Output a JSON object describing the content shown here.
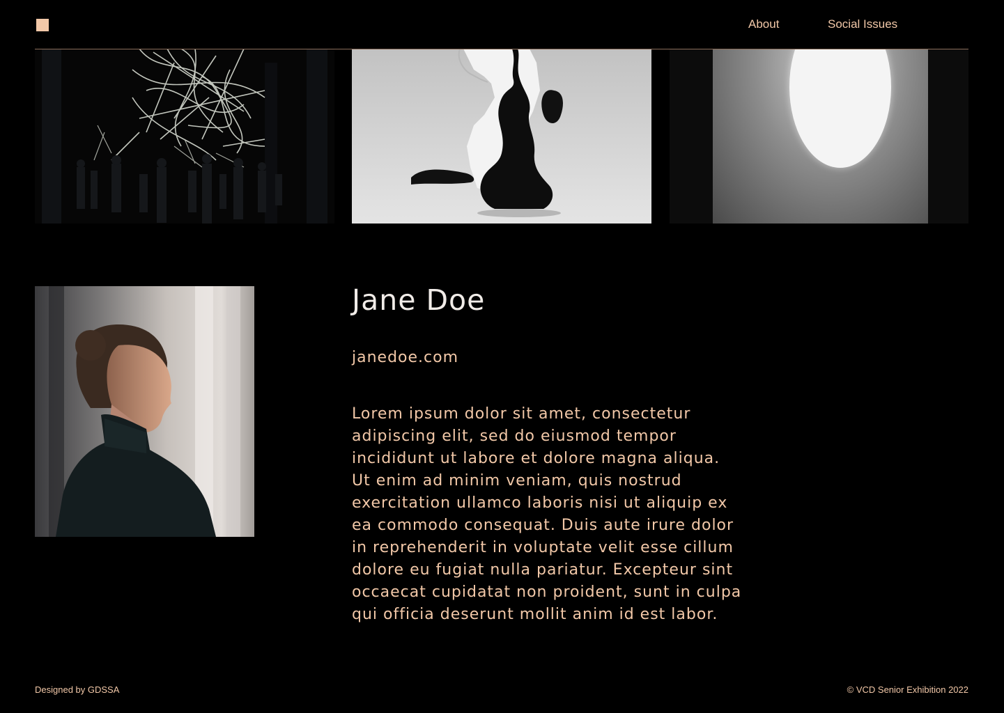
{
  "header": {
    "nav": [
      {
        "label": "About"
      },
      {
        "label": "Social Issues"
      }
    ]
  },
  "gallery": [
    {
      "icon": "light-installation-photo"
    },
    {
      "icon": "sculpture-photo"
    },
    {
      "icon": "light-oval-photo"
    }
  ],
  "profile": {
    "name": "Jane Doe",
    "website": "janedoe.com",
    "bio": "Lorem ipsum dolor sit amet, consectetur adipiscing elit, sed do eiusmod tempor incididunt ut labore et dolore magna aliqua. Ut enim ad minim veniam, quis nostrud exercitation ullamco laboris nisi ut aliquip ex ea commodo consequat. Duis aute irure dolor in reprehenderit in voluptate velit esse cillum dolore eu fugiat nulla pariatur. Excepteur sint occaecat cupidatat non proident, sunt in culpa qui officia deserunt mollit anim id est labor."
  },
  "footer": {
    "left": "Designed by GDSSA",
    "right": "© VCD Senior Exhibition 2022"
  },
  "colors": {
    "background": "#000000",
    "accent": "#f2c8a8",
    "heading": "#f1ece8"
  }
}
